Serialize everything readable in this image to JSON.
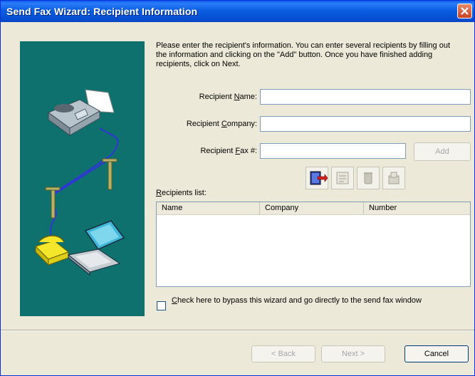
{
  "window": {
    "title": "Send Fax Wizard: Recipient Information"
  },
  "intro_text": "Please enter the recipient's information. You can enter several recipients by filling out the information and clicking on the \"Add\" button. Once you have finished adding recipients, click on Next.",
  "fields": {
    "name": {
      "pre": "Recipient ",
      "key": "N",
      "post": "ame:",
      "value": ""
    },
    "company": {
      "pre": "Recipient ",
      "key": "C",
      "post": "ompany:",
      "value": ""
    },
    "fax": {
      "pre": "Recipient ",
      "key": "F",
      "post": "ax #:",
      "value": ""
    }
  },
  "buttons": {
    "add": "Add",
    "back": "< Back",
    "next": "Next >",
    "cancel": "Cancel"
  },
  "recipients_list": {
    "label_key": "R",
    "label_rest": "ecipients list:",
    "columns": [
      "Name",
      "Company",
      "Number"
    ]
  },
  "bypass": {
    "key": "C",
    "rest": "heck here to bypass this wizard and go directly to the send fax window",
    "checked": false
  },
  "colors": {
    "titlebar": "#0a5ee8",
    "art_bg": "#0f716e",
    "cable": "#2f36d6"
  },
  "icons": [
    "close-icon",
    "address-book-icon",
    "recipient-details-icon",
    "delete-recipient-icon",
    "edit-recipient-icon",
    "fax-machine-icon",
    "telephone-icon",
    "laptop-icon"
  ]
}
